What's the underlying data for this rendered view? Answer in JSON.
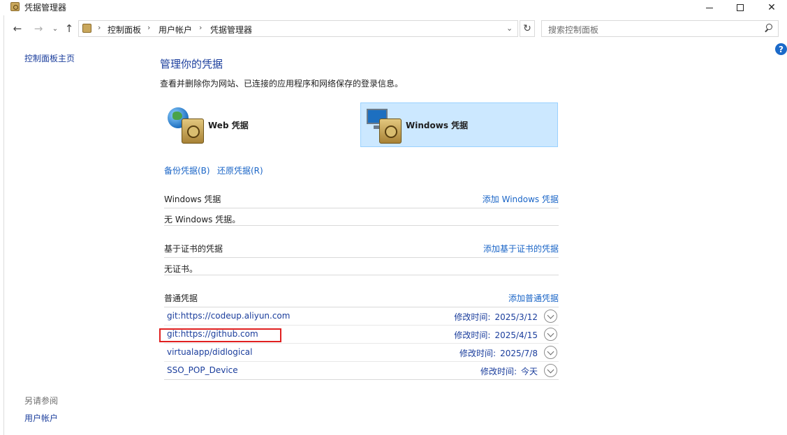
{
  "window": {
    "title": "凭据管理器"
  },
  "address": {
    "crumbs": [
      "控制面板",
      "用户帐户",
      "凭据管理器"
    ]
  },
  "search": {
    "placeholder": "搜索控制面板"
  },
  "sidebar": {
    "home": "控制面板主页",
    "see_also": "另请参阅",
    "user_accounts": "用户帐户"
  },
  "main": {
    "title": "管理你的凭据",
    "description": "查看并删除你为网站、已连接的应用程序和网络保存的登录信息。",
    "web_tile": "Web 凭据",
    "windows_tile": "Windows 凭据",
    "backup": "备份凭据(B)",
    "restore": "还原凭据(R)"
  },
  "sections": {
    "windows": {
      "title": "Windows 凭据",
      "add": "添加 Windows 凭据",
      "empty": "无 Windows 凭据。"
    },
    "cert": {
      "title": "基于证书的凭据",
      "add": "添加基于证书的凭据",
      "empty": "无证书。"
    },
    "generic": {
      "title": "普通凭据",
      "add": "添加普通凭据",
      "modified_label": "修改时间:",
      "items": [
        {
          "name": "git:https://codeup.aliyun.com",
          "date": "2025/3/12"
        },
        {
          "name": "git:https://github.com",
          "date": "2025/4/15"
        },
        {
          "name": "virtualapp/didlogical",
          "date": "2025/7/8"
        },
        {
          "name": "SSO_POP_Device",
          "date": "今天"
        }
      ]
    }
  },
  "icons": {
    "help": "?"
  },
  "colors": {
    "link": "#1a65c7",
    "selected_tile": "#cce8ff",
    "highlight": "#e02020"
  }
}
